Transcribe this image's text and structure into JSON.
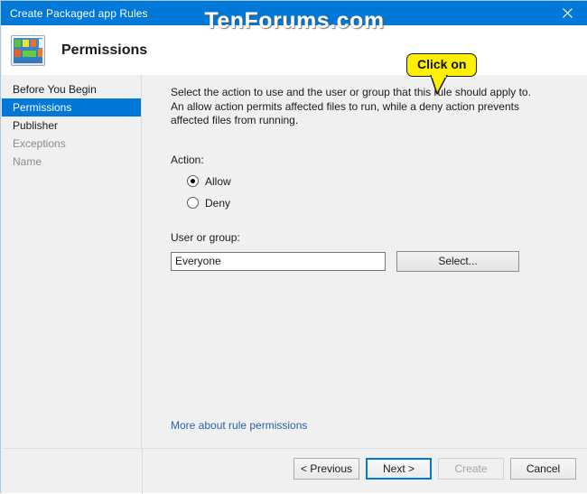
{
  "window": {
    "title": "Create Packaged app Rules",
    "close_icon": "close-icon",
    "watermark": "TenForums.com"
  },
  "header": {
    "icon": "packaged-app-icon",
    "title": "Permissions"
  },
  "sidebar": {
    "items": [
      {
        "label": "Before You Begin",
        "state": "normal"
      },
      {
        "label": "Permissions",
        "state": "selected"
      },
      {
        "label": "Publisher",
        "state": "normal"
      },
      {
        "label": "Exceptions",
        "state": "disabled"
      },
      {
        "label": "Name",
        "state": "disabled"
      }
    ]
  },
  "content": {
    "intro": "Select the action to use and the user or group that this rule should apply to. An allow action permits affected files to run, while a deny action prevents affected files from running.",
    "action_label": "Action:",
    "radios": [
      {
        "label": "Allow",
        "checked": true
      },
      {
        "label": "Deny",
        "checked": false
      }
    ],
    "usergroup_label": "User or group:",
    "usergroup_value": "Everyone",
    "usergroup_placeholder": "",
    "select_button": "Select...",
    "more_link": "More about rule permissions"
  },
  "callout": {
    "text": "Click on",
    "fill_color": "#ffef00",
    "border_color": "#1a1a1a"
  },
  "footer": {
    "buttons": [
      {
        "label": "< Previous",
        "state": "normal"
      },
      {
        "label": "Next >",
        "state": "default"
      },
      {
        "label": "Create",
        "state": "disabled"
      },
      {
        "label": "Cancel",
        "state": "normal"
      }
    ]
  },
  "colors": {
    "titlebar": "#0078d7",
    "accent": "#0078d7",
    "link": "#2a62b0",
    "dialog_bg": "#f0f0f0"
  }
}
